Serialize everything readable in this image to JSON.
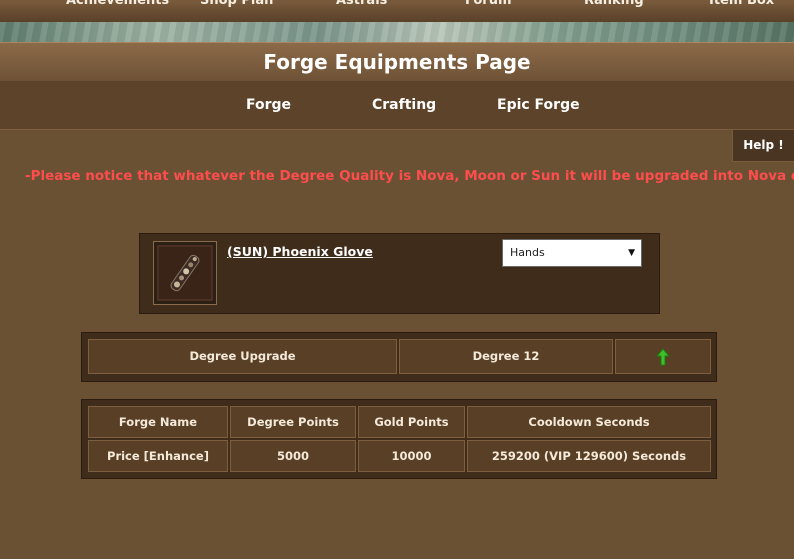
{
  "topnav": {
    "items": [
      "Achievements",
      "Shop Plan",
      "Astrals",
      "Forum",
      "Ranking",
      "Item Box"
    ]
  },
  "page": {
    "title": "Forge Equipments Page"
  },
  "subnav": {
    "tabs": [
      "Forge",
      "Crafting",
      "Epic Forge"
    ]
  },
  "help": {
    "label": "Help !"
  },
  "notice": "-Please notice that whatever the Degree Quality is Nova, Moon or Sun it will be upgraded into Nova only",
  "item": {
    "name": "(SUN) Phoenix Glove",
    "slot_selected": "Hands"
  },
  "degree": {
    "label": "Degree Upgrade",
    "value": "Degree 12",
    "upgrade_icon": "green-up-arrow-icon"
  },
  "forge_table": {
    "headers": [
      "Forge Name",
      "Degree Points",
      "Gold Points",
      "Cooldown Seconds"
    ],
    "row": [
      "Price [Enhance]",
      "5000",
      "10000",
      "259200 (VIP 129600) Seconds"
    ]
  },
  "colors": {
    "background": "#6b5134",
    "notice": "#ff4d4d",
    "upgrade_arrow": "#3fbf2a"
  }
}
